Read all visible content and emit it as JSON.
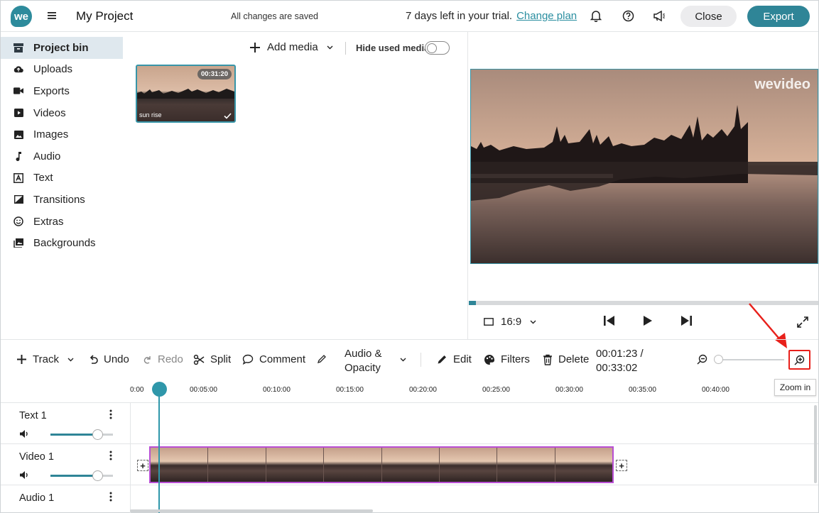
{
  "header": {
    "logo_text": "we",
    "project_title": "My Project",
    "save_status": "All changes are saved",
    "trial_text": "7 days left in your trial.",
    "change_plan_link": "Change plan",
    "close_label": "Close",
    "export_label": "Export",
    "accent_color": "#2f8597"
  },
  "sidebar": {
    "items": [
      {
        "label": "Project bin",
        "icon": "archive-icon",
        "active": true
      },
      {
        "label": "Uploads",
        "icon": "cloud-upload-icon"
      },
      {
        "label": "Exports",
        "icon": "video-camera-icon"
      },
      {
        "label": "Videos",
        "icon": "play-box-icon"
      },
      {
        "label": "Images",
        "icon": "image-icon"
      },
      {
        "label": "Audio",
        "icon": "music-note-icon"
      },
      {
        "label": "Text",
        "icon": "text-box-icon"
      },
      {
        "label": "Transitions",
        "icon": "transition-icon"
      },
      {
        "label": "Extras",
        "icon": "smiley-icon"
      },
      {
        "label": "Backgrounds",
        "icon": "images-stack-icon"
      }
    ]
  },
  "media": {
    "add_media_label": "Add media",
    "hide_used_label": "Hide used media",
    "hide_used_on": false,
    "items": [
      {
        "name": "sun rise",
        "duration": "00:31:20",
        "used": true
      }
    ]
  },
  "preview": {
    "watermark": "wevideo",
    "aspect_ratio": "16:9",
    "progress": 0.02
  },
  "toolbar": {
    "track_label": "Track",
    "undo_label": "Undo",
    "redo_label": "Redo",
    "split_label": "Split",
    "comment_label": "Comment",
    "audio_opacity_line1": "Audio &",
    "audio_opacity_line2": "Opacity",
    "edit_label": "Edit",
    "filters_label": "Filters",
    "delete_label": "Delete",
    "current_time": "00:01:23 /",
    "total_time": "00:33:02",
    "zoom_in_tooltip": "Zoom in",
    "highlight_color": "#e8201b"
  },
  "ruler": {
    "ticks": [
      "0:00",
      "00:05:00",
      "00:10:00",
      "00:15:00",
      "00:20:00",
      "00:25:00",
      "00:30:00",
      "00:35:00",
      "00:40:00"
    ]
  },
  "tracks": [
    {
      "name": "Text 1",
      "volume": 0.75
    },
    {
      "name": "Video 1",
      "volume": 0.75
    },
    {
      "name": "Audio 1"
    }
  ]
}
